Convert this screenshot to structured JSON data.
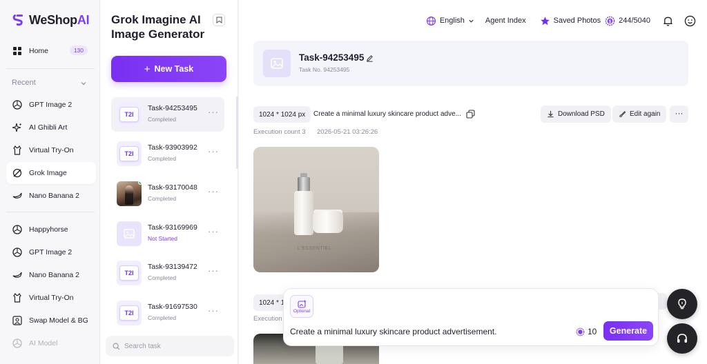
{
  "app": {
    "brand": "WeShop",
    "brand_suffix": "AI"
  },
  "sidebar": {
    "home": {
      "label": "Home",
      "badge": "130"
    },
    "recent_label": "Recent",
    "recent": [
      {
        "label": "GPT Image 2",
        "icon": "openai-icon"
      },
      {
        "label": "AI Ghibli Art",
        "icon": "sparkle-icon"
      },
      {
        "label": "Virtual Try-On",
        "icon": "hanger-icon"
      },
      {
        "label": "Grok Image",
        "icon": "grok-icon",
        "active": true
      },
      {
        "label": "Nano Banana 2",
        "icon": "banana-icon"
      }
    ],
    "tools": [
      {
        "label": "Happyhorse",
        "icon": "openai-icon"
      },
      {
        "label": "GPT Image 2",
        "icon": "openai-icon"
      },
      {
        "label": "Nano Banana 2",
        "icon": "banana-icon"
      },
      {
        "label": "Virtual Try-On",
        "icon": "hanger-icon"
      },
      {
        "label": "Swap Model & BG",
        "icon": "swap-icon"
      },
      {
        "label": "AI Model",
        "icon": "openai-icon"
      }
    ]
  },
  "taskpanel": {
    "title": "Grok Imagine AI Image Generator",
    "new_task_label": "New Task",
    "search_placeholder": "Search task",
    "tasks": [
      {
        "name": "Task-94253495",
        "status": "Completed",
        "thumb": "T2I"
      },
      {
        "name": "Task-93903992",
        "status": "Completed",
        "thumb": "T2I"
      },
      {
        "name": "Task-93170048",
        "status": "Completed",
        "thumb": "image"
      },
      {
        "name": "Task-93169969",
        "status": "Not Started",
        "thumb": "placeholder"
      },
      {
        "name": "Task-93139472",
        "status": "Completed",
        "thumb": "T2I"
      },
      {
        "name": "Task-91697530",
        "status": "Completed",
        "thumb": "T2I"
      }
    ]
  },
  "topbar": {
    "language": "English",
    "agent_index": "Agent Index",
    "saved_photos": "Saved Photos",
    "credits": "244/5040"
  },
  "task": {
    "title": "Task-94253495",
    "task_no": "Task No. 94253495",
    "results": [
      {
        "size": "1024 * 1024 px",
        "prompt": "Create a minimal luxury skincare product adve...",
        "download_label": "Download PSD",
        "edit_label": "Edit again",
        "execution_count": "Execution count 3",
        "timestamp": "2026-05-21 03:26:26",
        "image_brand_text": "L'ESSENTIEL"
      },
      {
        "size": "1024 * 1",
        "execution_label": "Execution"
      }
    ]
  },
  "composer": {
    "optional_label": "Optional",
    "prompt_value": "Create a minimal luxury skincare product advertisement.",
    "cost": "10",
    "generate_label": "Generate"
  },
  "colors": {
    "accent": "#7b3cf5",
    "accent_light": "#ece6fd",
    "dark_button": "#232328"
  }
}
